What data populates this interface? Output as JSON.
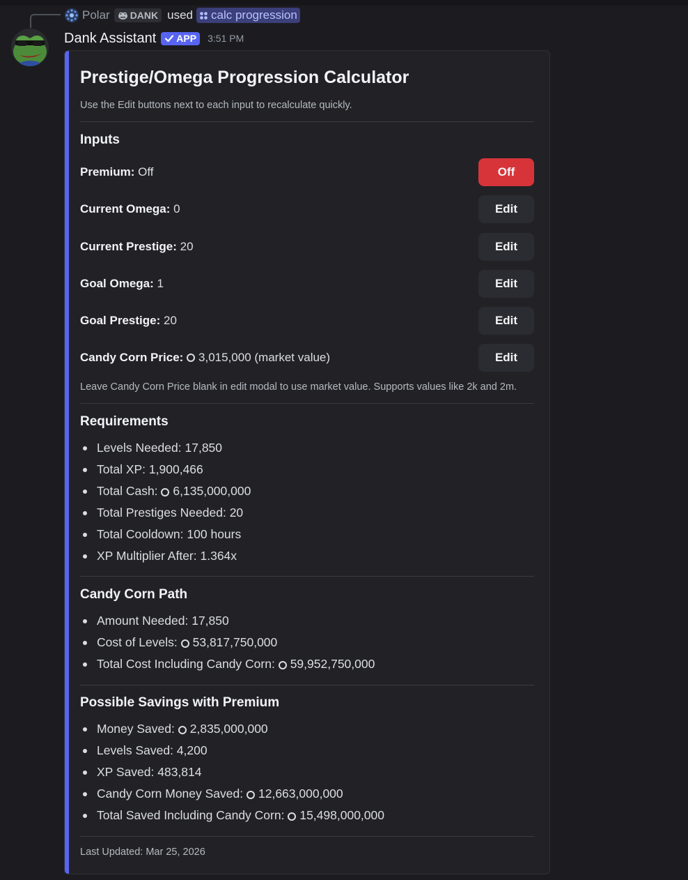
{
  "reply": {
    "user": "Polar",
    "tag": "DANK",
    "used_text": "used",
    "command": "calc progression"
  },
  "author": {
    "name": "Dank Assistant",
    "badge": "APP",
    "timestamp": "3:51 PM"
  },
  "embed": {
    "title": "Prestige/Omega Progression Calculator",
    "subtitle": "Use the Edit buttons next to each input to recalculate quickly.",
    "accent_color": "#5865f2",
    "inputs": {
      "heading": "Inputs",
      "rows": [
        {
          "label": "Premium:",
          "value": "Off",
          "button": "Off"
        },
        {
          "label": "Current Omega:",
          "value": "0",
          "button": "Edit"
        },
        {
          "label": "Current Prestige:",
          "value": "20",
          "button": "Edit"
        },
        {
          "label": "Goal Omega:",
          "value": "1",
          "button": "Edit"
        },
        {
          "label": "Goal Prestige:",
          "value": "20",
          "button": "Edit"
        },
        {
          "label": "Candy Corn Price:",
          "value": "3,015,000 (market value)",
          "button": "Edit"
        }
      ],
      "note": "Leave Candy Corn Price blank in edit modal to use market value. Supports values like 2k and 2m."
    },
    "requirements": {
      "heading": "Requirements",
      "items": [
        {
          "label": "Levels Needed:",
          "value": "17,850"
        },
        {
          "label": "Total XP:",
          "value": "1,900,466"
        },
        {
          "label": "Total Cash:",
          "value": "6,135,000,000"
        },
        {
          "label": "Total Prestiges Needed:",
          "value": "20"
        },
        {
          "label": "Total Cooldown:",
          "value": "100 hours"
        },
        {
          "label": "XP Multiplier After:",
          "value": "1.364x"
        }
      ]
    },
    "candy_corn_path": {
      "heading": "Candy Corn Path",
      "items": [
        {
          "label": "Amount Needed:",
          "value": "17,850"
        },
        {
          "label": "Cost of Levels:",
          "value": "53,817,750,000"
        },
        {
          "label": "Total Cost Including Candy Corn:",
          "value": "59,952,750,000"
        }
      ]
    },
    "premium_savings": {
      "heading": "Possible Savings with Premium",
      "items": [
        {
          "label": "Money Saved:",
          "value": "2,835,000,000"
        },
        {
          "label": "Levels Saved:",
          "value": "4,200"
        },
        {
          "label": "XP Saved:",
          "value": "483,814"
        },
        {
          "label": "Candy Corn Money Saved:",
          "value": "12,663,000,000"
        },
        {
          "label": "Total Saved Including Candy Corn:",
          "value": "15,498,000,000"
        }
      ]
    },
    "footer": "Last Updated: Mar 25, 2026"
  }
}
